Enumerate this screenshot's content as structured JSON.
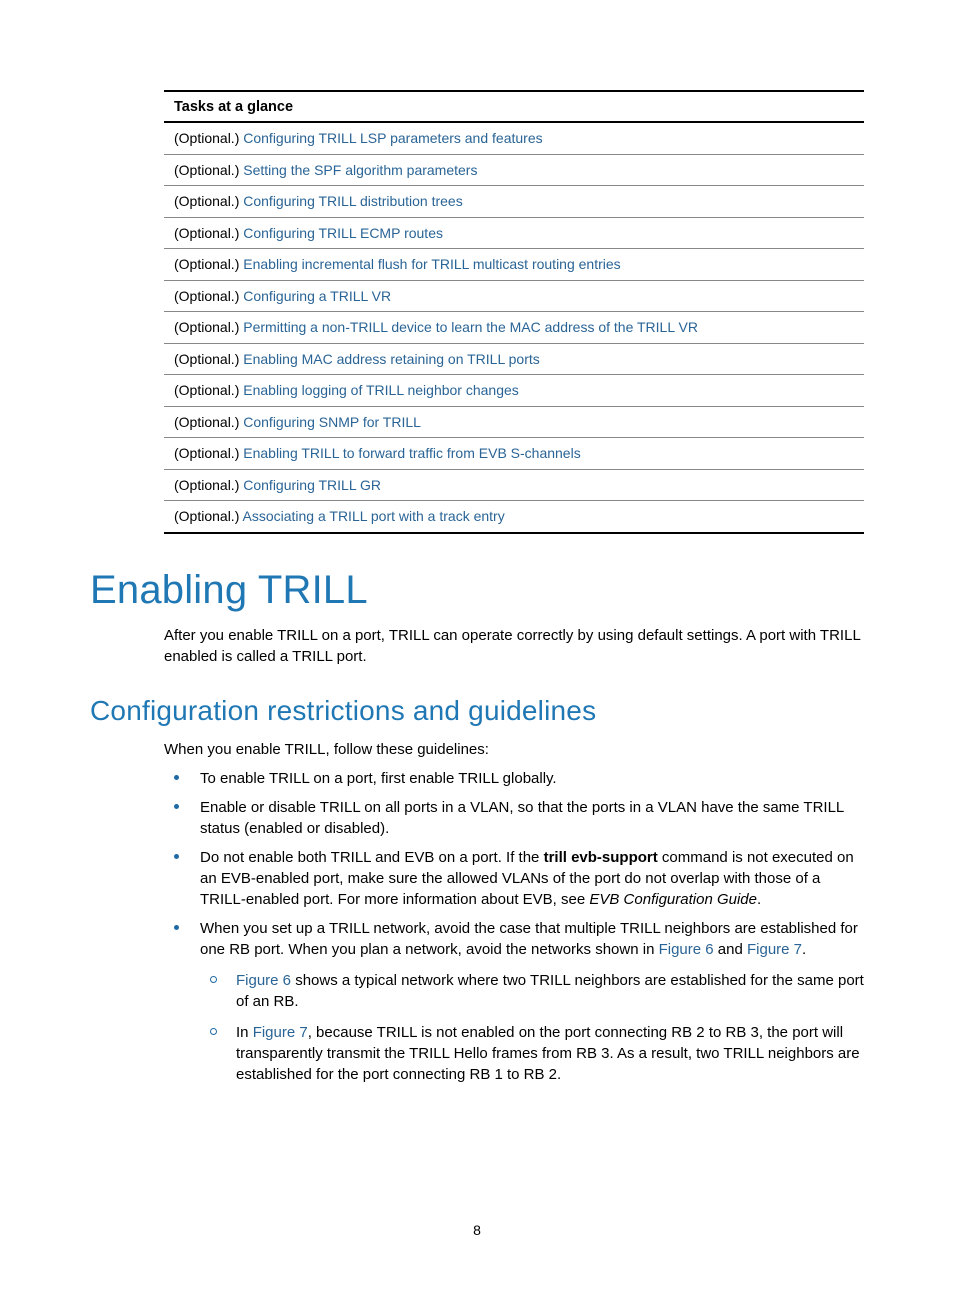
{
  "table": {
    "header": "Tasks at a glance",
    "prefix": "(Optional.) ",
    "rows": [
      "Configuring TRILL LSP parameters and features",
      "Setting the SPF algorithm parameters",
      "Configuring TRILL distribution trees",
      "Configuring TRILL ECMP routes",
      "Enabling incremental flush for TRILL multicast routing entries",
      "Configuring a TRILL VR",
      "Permitting a non-TRILL device to learn the MAC address of the TRILL VR",
      "Enabling MAC address retaining on TRILL ports",
      "Enabling logging of TRILL neighbor changes",
      "Configuring SNMP for TRILL",
      "Enabling TRILL to forward traffic from EVB S-channels",
      "Configuring TRILL GR",
      "Associating a TRILL port with a track entry"
    ]
  },
  "h1": "Enabling TRILL",
  "intro": "After you enable TRILL on a port, TRILL can operate correctly by using default settings. A port with TRILL enabled is called a TRILL port.",
  "h2": "Configuration restrictions and guidelines",
  "guidelines_intro": "When you enable TRILL, follow these guidelines:",
  "bullets": {
    "b1": "To enable TRILL on a port, first enable TRILL globally.",
    "b2": "Enable or disable TRILL on all ports in a VLAN, so that the ports in a VLAN have the same TRILL status (enabled or disabled).",
    "b3a": "Do not enable both TRILL and EVB on a port. If the ",
    "b3bold": "trill evb-support",
    "b3b": " command is not executed on an EVB-enabled port, make sure the allowed VLANs of the port do not overlap with those of a TRILL-enabled port. For more information about EVB, see ",
    "b3i": "EVB Configuration Guide",
    "b3c": ".",
    "b4a": "When you set up a TRILL network, avoid the case that multiple TRILL neighbors are established for one RB port. When you plan a network, avoid the networks shown in ",
    "fig6": "Figure 6",
    "and": " and ",
    "fig7": "Figure 7",
    "b4b": ".",
    "s1a": " shows a typical network where two TRILL neighbors are established for the same port of an RB.",
    "s2a": "In ",
    "s2b": ", because TRILL is not enabled on the port connecting RB 2 to RB 3, the port will transparently transmit the TRILL Hello frames from RB 3. As a result, two TRILL neighbors are established for the port connecting RB 1 to RB 2."
  },
  "page_number": "8"
}
